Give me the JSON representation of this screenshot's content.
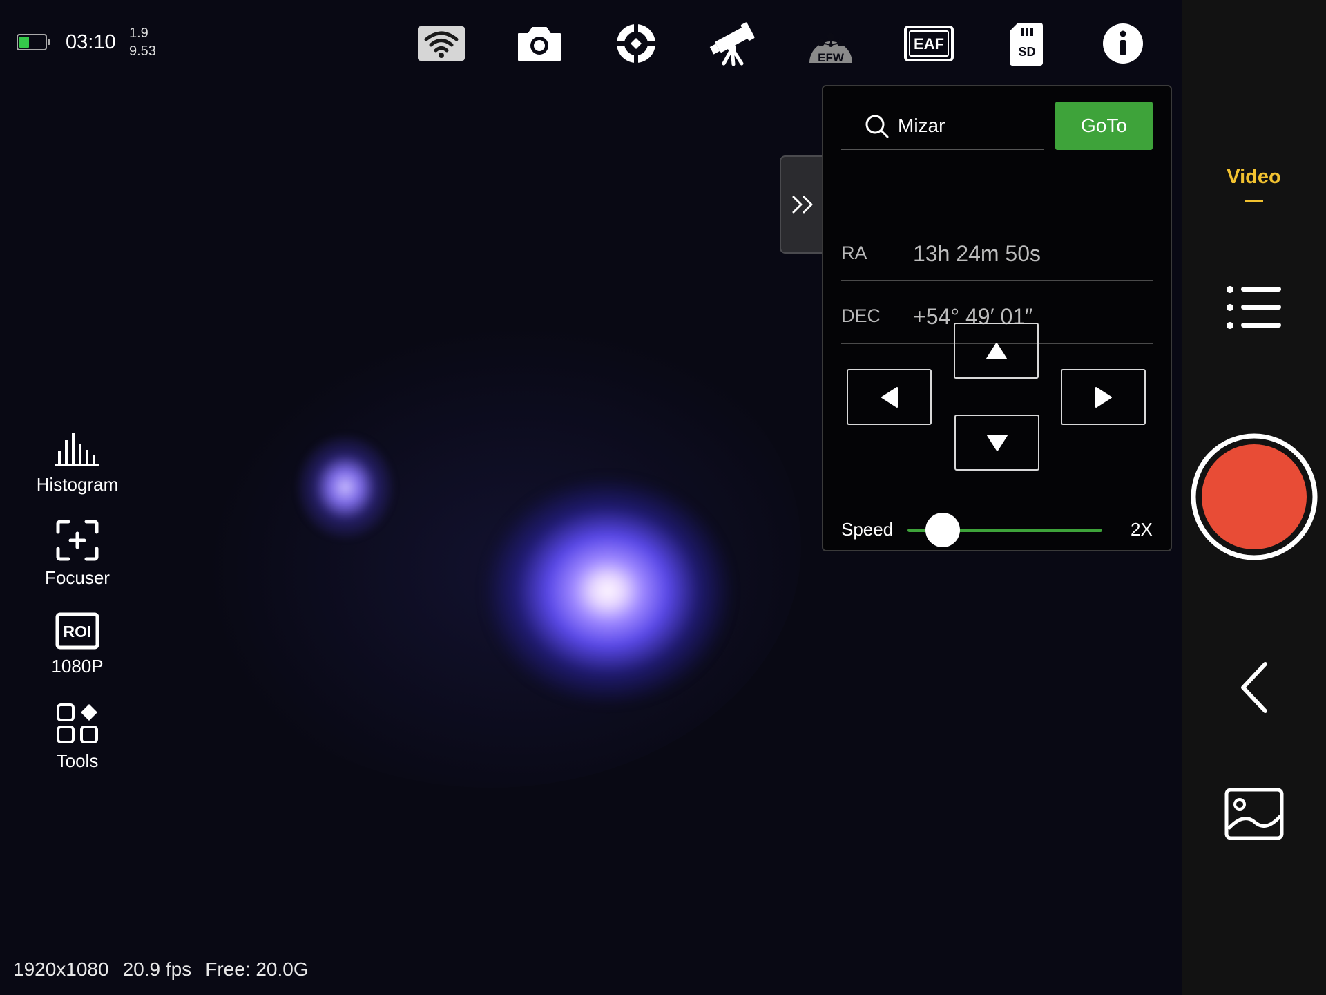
{
  "status": {
    "time": "03:10",
    "stat_top": "1.9",
    "stat_bottom": "9.53",
    "battery_color": "#35c84a"
  },
  "toolbar": {
    "icons": [
      "wifi-icon",
      "camera-icon",
      "crosshair-icon",
      "telescope-icon",
      "efw-icon",
      "eaf-icon",
      "sd-card-icon",
      "info-icon"
    ],
    "efw_label": "EFW",
    "eaf_label": "EAF",
    "sd_label": "SD"
  },
  "left_tools": {
    "histogram": "Histogram",
    "focuser": "Focuser",
    "roi_badge": "ROI",
    "roi": "1080P",
    "tools": "Tools"
  },
  "goto_panel": {
    "search_value": "Mizar",
    "goto_label": "GoTo",
    "ra_label": "RA",
    "ra_value": "13h 24m 50s",
    "dec_label": "DEC",
    "dec_value": "+54° 49′ 01″",
    "speed_label": "Speed",
    "speed_value": "2X",
    "speed_level": 0.2,
    "accent_color": "#3ea33a"
  },
  "right_rail": {
    "mode": "Video",
    "mode_color": "#f2c230",
    "record_color": "#e84c36"
  },
  "footer": {
    "resolution": "1920x1080",
    "fps": "20.9 fps",
    "free": "Free: 20.0G"
  }
}
